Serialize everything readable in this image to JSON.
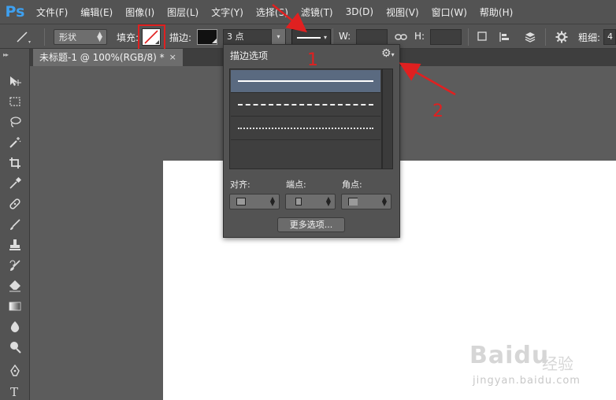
{
  "menubar": {
    "logo": "Ps",
    "items": [
      "文件(F)",
      "编辑(E)",
      "图像(I)",
      "图层(L)",
      "文字(Y)",
      "选择(S)",
      "滤镜(T)",
      "3D(D)",
      "视图(V)",
      "窗口(W)",
      "帮助(H)"
    ]
  },
  "options": {
    "mode_value": "形状",
    "fill_label": "填充:",
    "stroke_label": "描边:",
    "stroke_width_value": "3 点",
    "w_label": "W:",
    "h_label": "H:",
    "thickness_label": "粗细:",
    "thickness_value": "4"
  },
  "tab": {
    "title": "未标题-1 @ 100%(RGB/8) *",
    "close": "×"
  },
  "panel": {
    "title": "描边选项",
    "styles": [
      "solid",
      "dashed",
      "dotted"
    ],
    "align_label": "对齐:",
    "caps_label": "端点:",
    "corners_label": "角点:",
    "more_button": "更多选项..."
  },
  "annotations": {
    "label_1": "1",
    "label_2": "2",
    "color": "#e02020"
  },
  "watermark": {
    "brand": "Baidu",
    "brand_cn": "经验",
    "url": "jingyan.baidu.com"
  },
  "colors": {
    "ui_gray": "#535353",
    "canvas": "#ffffff",
    "selection_blue": "#5a6a80"
  }
}
